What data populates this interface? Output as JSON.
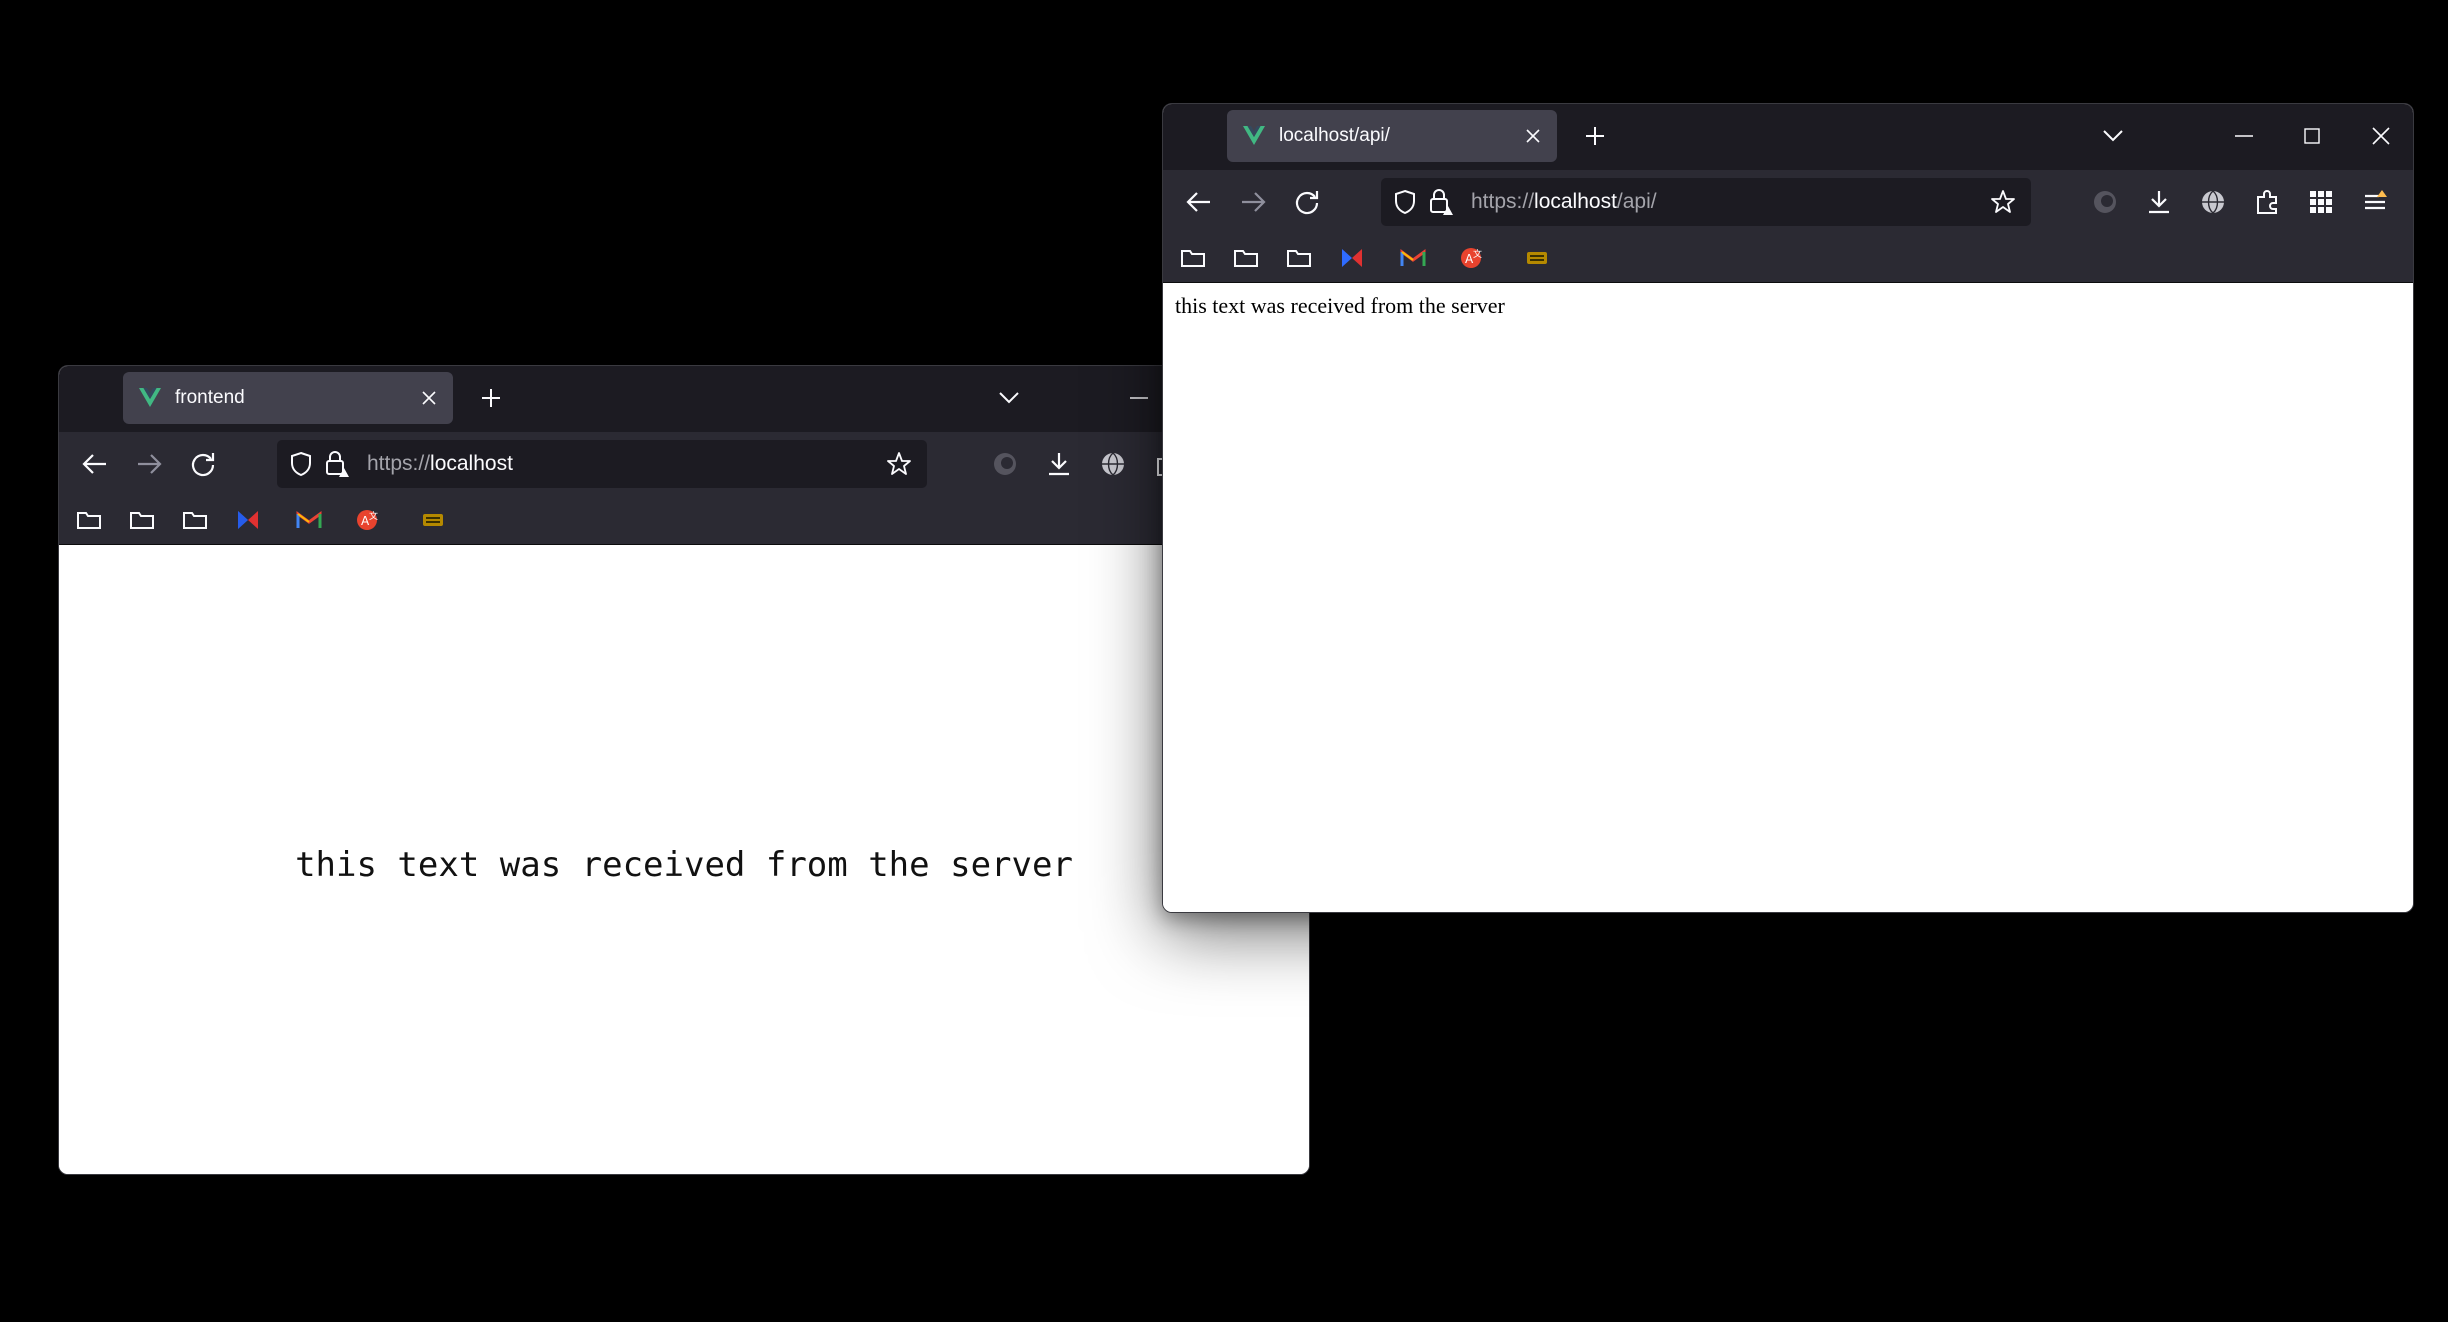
{
  "windows": [
    {
      "tab_title": "frontend",
      "url_scheme": "https://",
      "url_host": "localhost",
      "url_path": "",
      "body_text": "this text was received from the server"
    },
    {
      "tab_title": "localhost/api/",
      "url_scheme": "https://",
      "url_host": "localhost",
      "url_path": "/api/",
      "body_text": "this text was received from the server"
    }
  ],
  "colors": {
    "tabbar_bg": "#1c1b22",
    "toolbar_bg": "#2b2a33",
    "active_tab_bg": "#42414d",
    "urlbar_bg": "#1c1b22",
    "vue_green": "#41b883"
  },
  "bookmark_icons": [
    "folder-icon",
    "folder-icon",
    "folder-icon",
    "bowtie-app-icon",
    "gmail-icon",
    "translate-icon",
    "keyboard-icon"
  ],
  "toolbar_icons": [
    "back-arrow-icon",
    "forward-arrow-icon",
    "reload-icon",
    "shield-icon",
    "lock-icon",
    "star-icon",
    "account-icon",
    "download-icon",
    "globe-icon",
    "extensions-icon",
    "apps-grid-icon",
    "menu-icon"
  ]
}
